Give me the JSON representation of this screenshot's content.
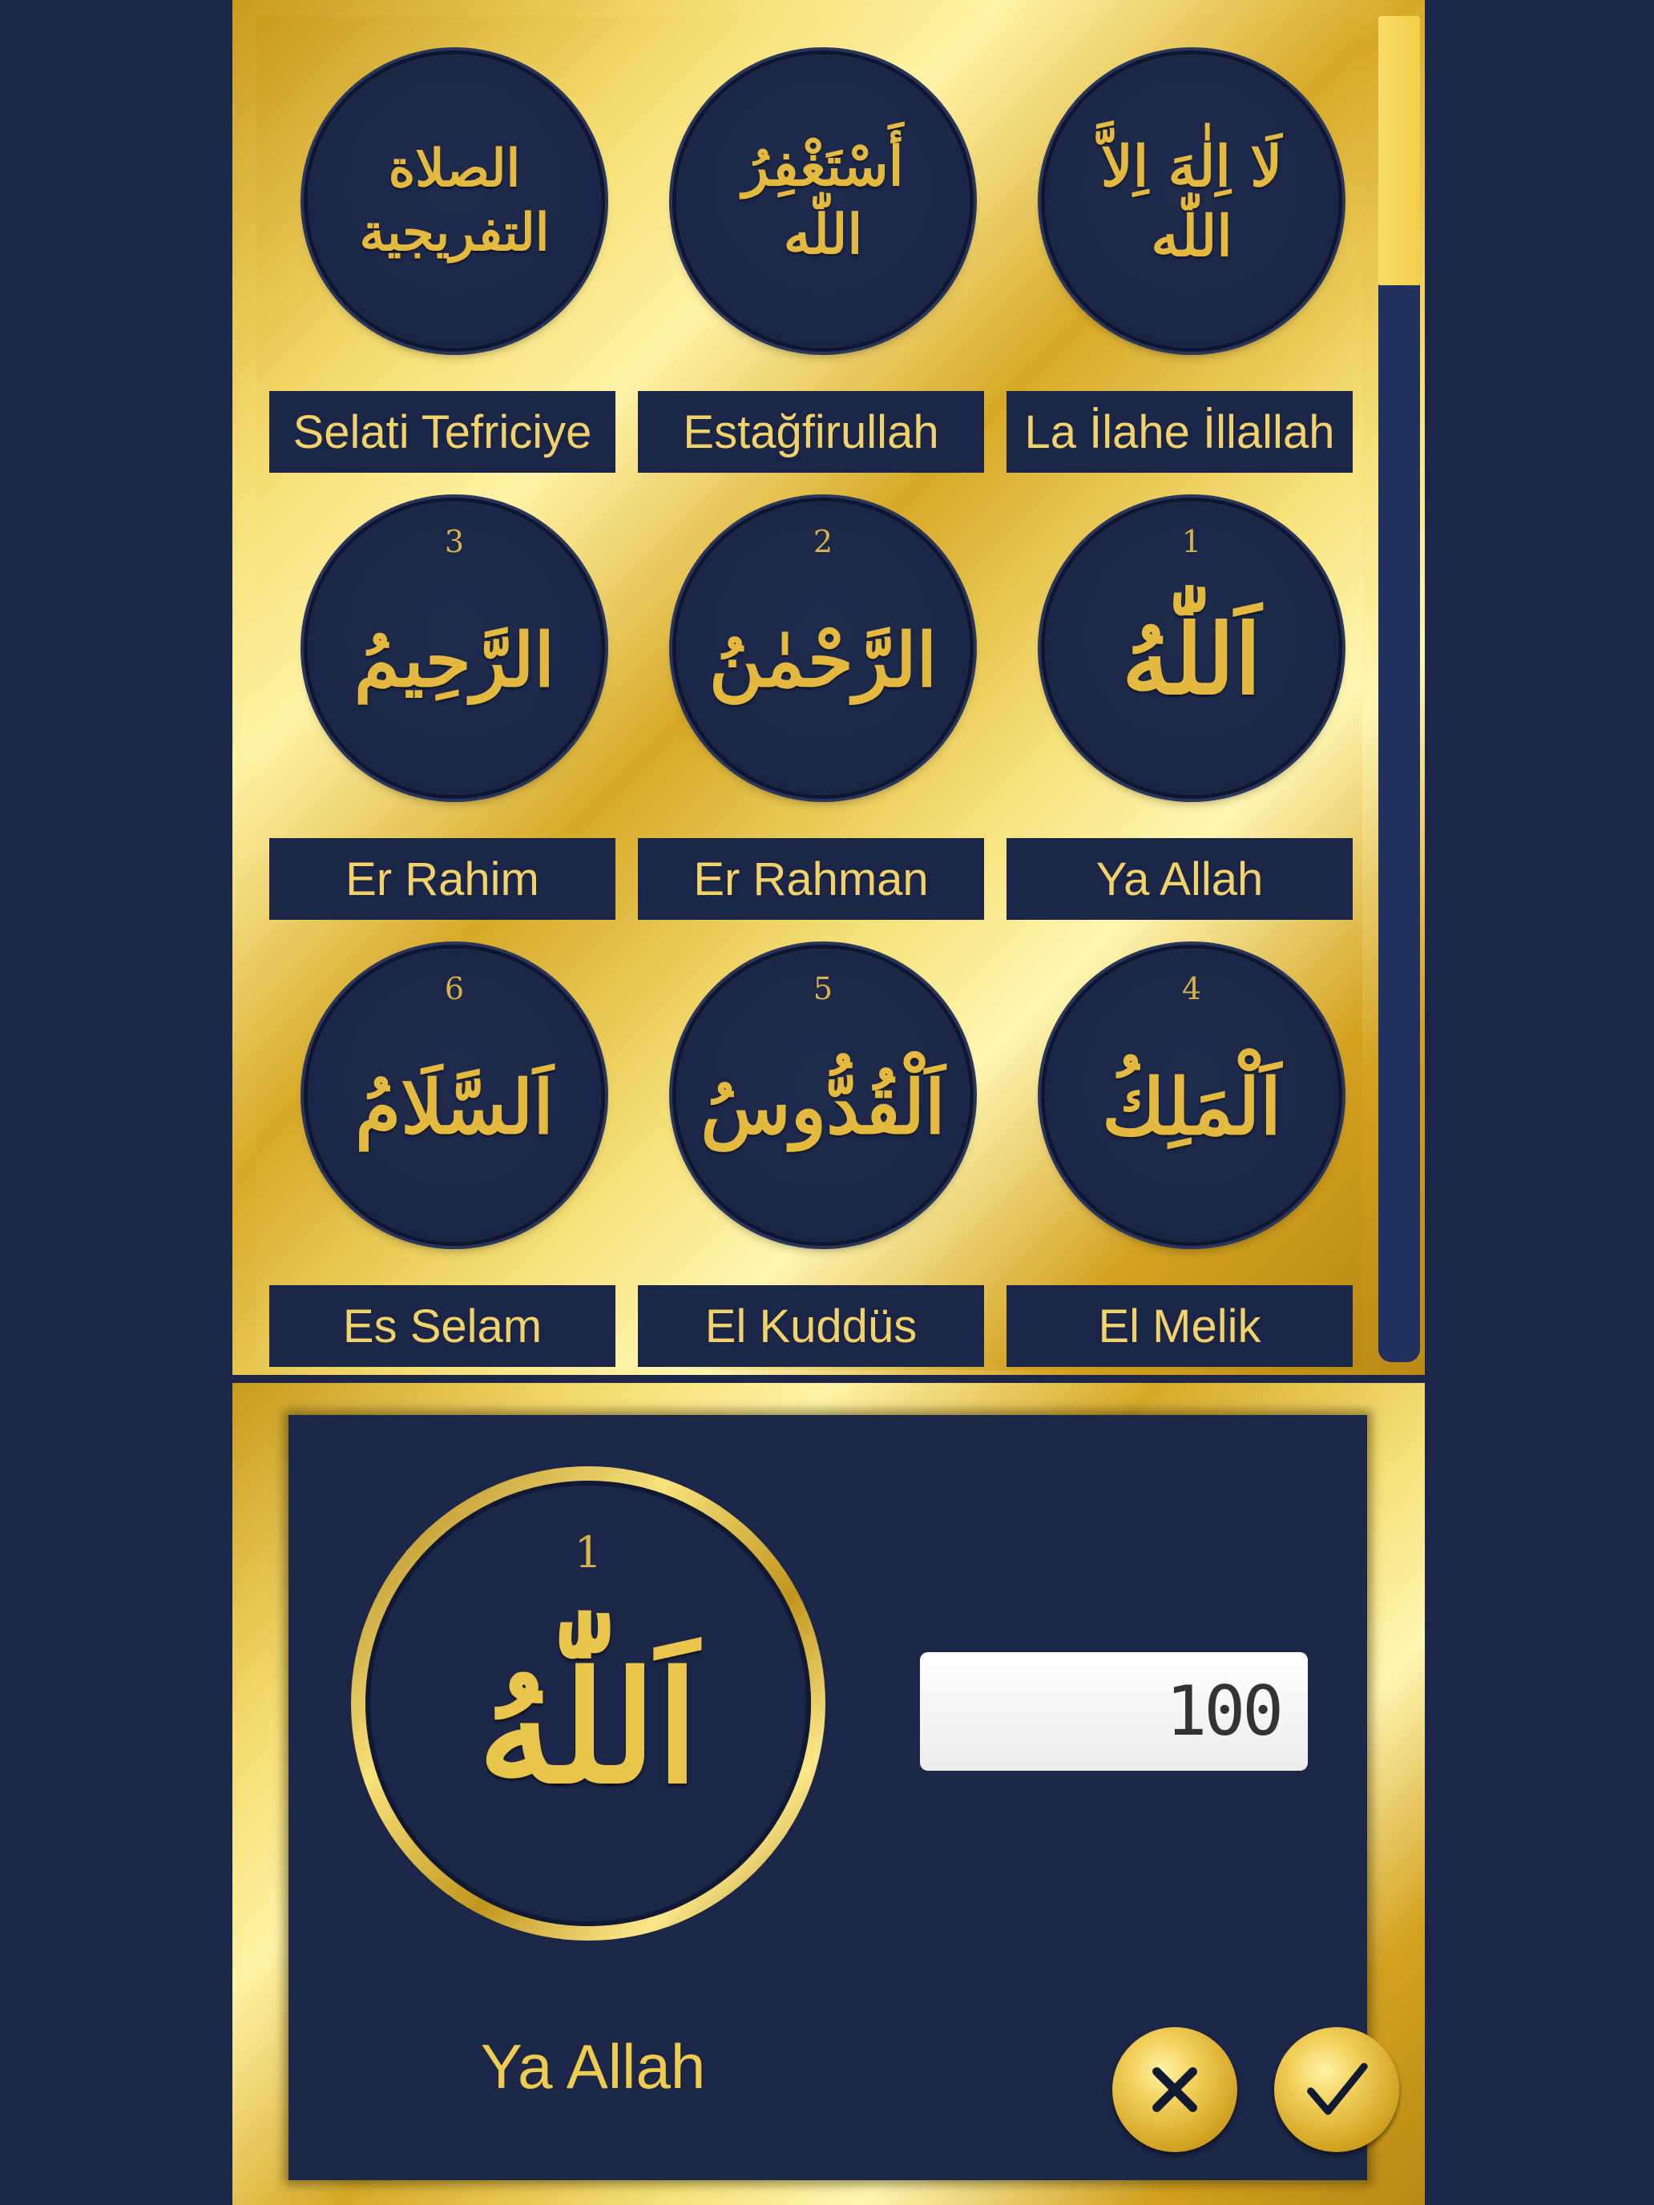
{
  "grid": {
    "items": [
      {
        "arabic": "الصلاة التفريجية",
        "number": "",
        "label": "Selati Tefriciye"
      },
      {
        "arabic": "أَسْتَغْفِرُ اللّٰه",
        "number": "",
        "label": "Estağfirullah"
      },
      {
        "arabic": "لَا اِلٰهَ اِلاَّ اللّٰه",
        "number": "",
        "label": "La İlahe İllallah"
      },
      {
        "arabic": "الرَّحِيمُ",
        "number": "3",
        "label": "Er Rahim"
      },
      {
        "arabic": "الرَّحْمٰنُ",
        "number": "2",
        "label": "Er Rahman"
      },
      {
        "arabic": "اَللّٰهُ",
        "number": "1",
        "label": "Ya Allah"
      },
      {
        "arabic": "اَلسَّلَامُ",
        "number": "6",
        "label": "Es Selam"
      },
      {
        "arabic": "اَلْقُدُّوسُ",
        "number": "5",
        "label": "El Kuddüs"
      },
      {
        "arabic": "اَلْمَلِكُ",
        "number": "4",
        "label": "El Melik"
      }
    ]
  },
  "dialog": {
    "selected_number": "1",
    "selected_arabic": "اَللّٰهُ",
    "selected_name": "Ya Allah",
    "count_value": "100",
    "cancel_icon": "close-icon",
    "confirm_icon": "check-icon"
  },
  "scrollbar": {
    "position": 0
  }
}
